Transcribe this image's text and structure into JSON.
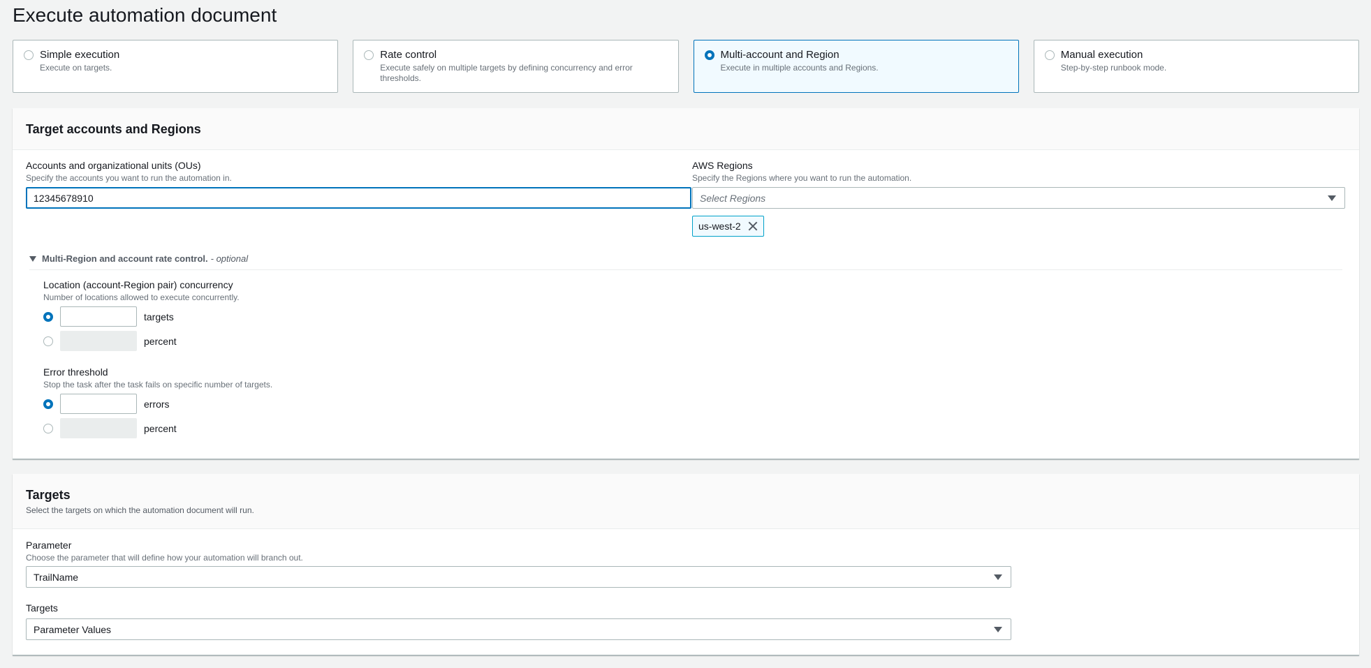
{
  "page": {
    "title": "Execute automation document"
  },
  "modes": [
    {
      "label": "Simple execution",
      "desc": "Execute on targets.",
      "selected": false
    },
    {
      "label": "Rate control",
      "desc": "Execute safely on multiple targets by defining concurrency and error thresholds.",
      "selected": false
    },
    {
      "label": "Multi-account and Region",
      "desc": "Execute in multiple accounts and Regions.",
      "selected": true
    },
    {
      "label": "Manual execution",
      "desc": "Step-by-step runbook mode.",
      "selected": false
    }
  ],
  "target_accounts": {
    "title": "Target accounts and Regions",
    "accounts": {
      "label": "Accounts and organizational units (OUs)",
      "desc": "Specify the accounts you want to run the automation in.",
      "value": "12345678910"
    },
    "regions": {
      "label": "AWS Regions",
      "desc": "Specify the Regions where you want to run the automation.",
      "placeholder": "Select Regions",
      "tokens": [
        "us-west-2"
      ]
    },
    "rate_control": {
      "title": "Multi-Region and account rate control.",
      "optional": "- optional",
      "concurrency": {
        "label": "Location (account-Region pair) concurrency",
        "desc": "Number of locations allowed to execute concurrently.",
        "option_targets": "targets",
        "option_percent": "percent"
      },
      "error_threshold": {
        "label": "Error threshold",
        "desc": "Stop the task after the task fails on specific number of targets.",
        "option_errors": "errors",
        "option_percent": "percent"
      }
    }
  },
  "targets": {
    "title": "Targets",
    "desc": "Select the targets on which the automation document will run.",
    "parameter": {
      "label": "Parameter",
      "desc": "Choose the parameter that will define how your automation will branch out.",
      "value": "TrailName"
    },
    "targets_field": {
      "label": "Targets",
      "value": "Parameter Values"
    }
  },
  "colors": {
    "accent": "#0073bb",
    "selected_bg": "#f1faff",
    "token_border": "#00a1c9"
  }
}
